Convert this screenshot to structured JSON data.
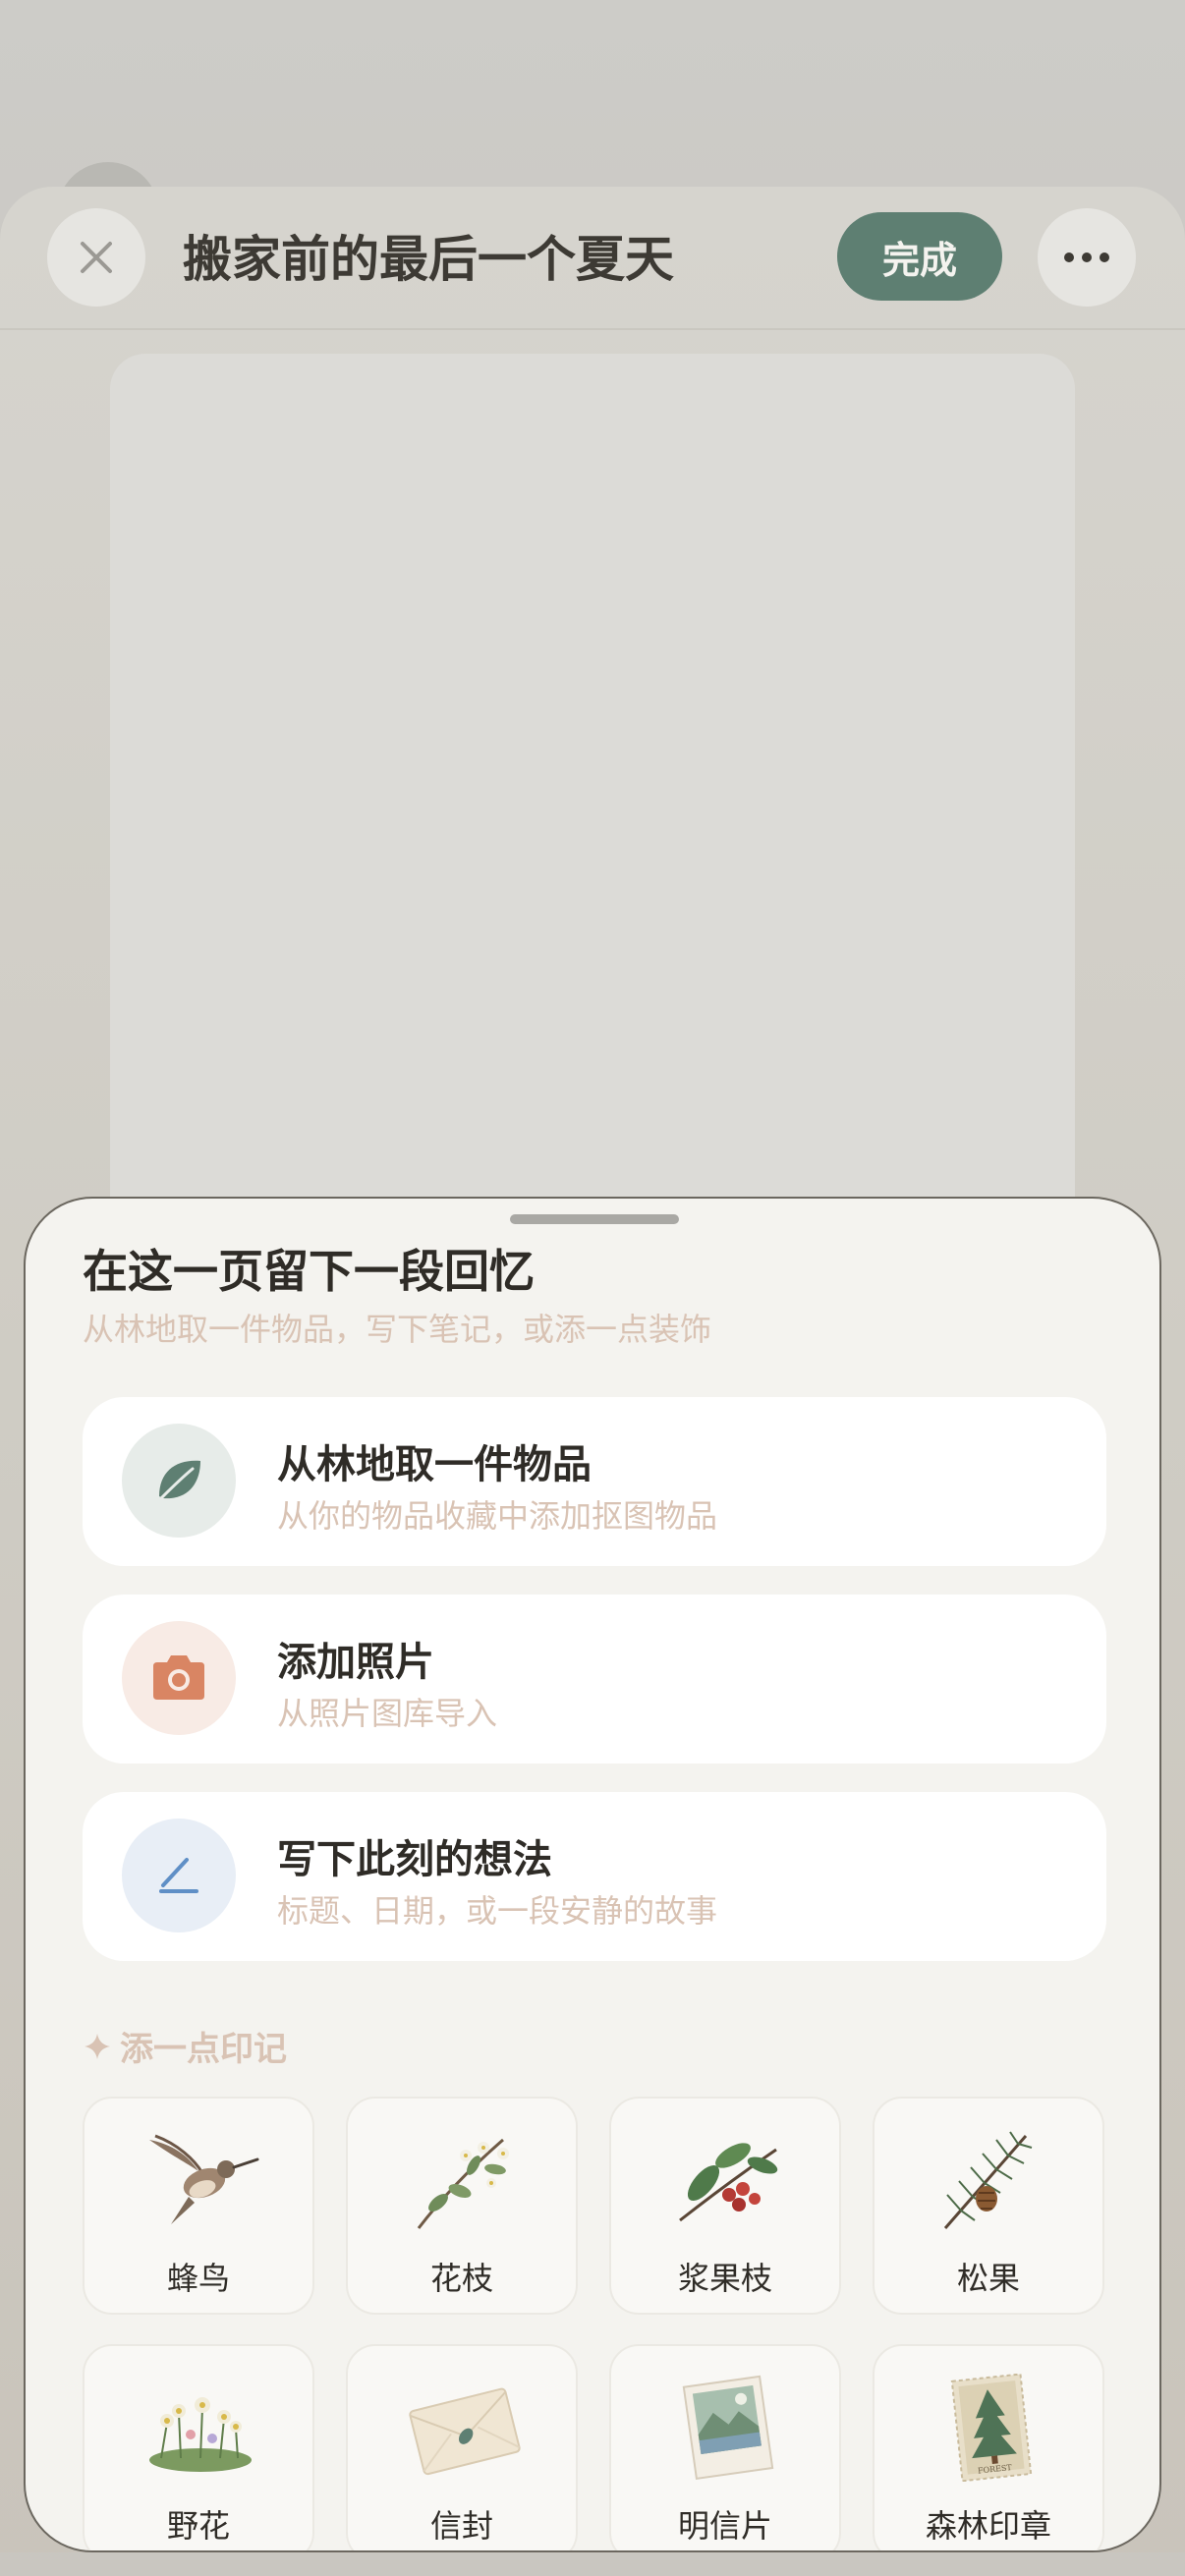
{
  "header": {
    "title": "搬家前的最后一个夏天",
    "done_label": "完成",
    "close_icon": "close-icon",
    "more_icon": "more-icon"
  },
  "sheet": {
    "title": "在这一页留下一段回忆",
    "subtitle": "从林地取一件物品，写下笔记，或添一点装饰",
    "actions": [
      {
        "title": "从林地取一件物品",
        "subtitle": "从你的物品收藏中添加抠图物品",
        "icon": "leaf-icon",
        "icon_bg": "#e7ece9",
        "icon_color": "#5e7f72"
      },
      {
        "title": "添加照片",
        "subtitle": "从照片图库导入",
        "icon": "camera-icon",
        "icon_bg": "#f8ebe5",
        "icon_color": "#d98563"
      },
      {
        "title": "写下此刻的想法",
        "subtitle": "标题、日期，或一段安静的故事",
        "icon": "pen-icon",
        "icon_bg": "#e8eef6",
        "icon_color": "#5f8fc6"
      }
    ],
    "stamps_heading": "添一点印记",
    "stamps": [
      {
        "label": "蜂鸟",
        "icon": "hummingbird-icon"
      },
      {
        "label": "花枝",
        "icon": "flower-branch-icon"
      },
      {
        "label": "浆果枝",
        "icon": "berry-branch-icon"
      },
      {
        "label": "松果",
        "icon": "pinecone-icon"
      },
      {
        "label": "野花",
        "icon": "wildflowers-icon"
      },
      {
        "label": "信封",
        "icon": "envelope-icon"
      },
      {
        "label": "明信片",
        "icon": "postcard-icon"
      },
      {
        "label": "森林印章",
        "icon": "forest-stamp-icon"
      }
    ],
    "forest_stamp_text": "FOREST"
  },
  "colors": {
    "accent": "#5e7f72",
    "muted_text": "#d9c3b4",
    "sheet_bg": "#f4f3ef"
  }
}
